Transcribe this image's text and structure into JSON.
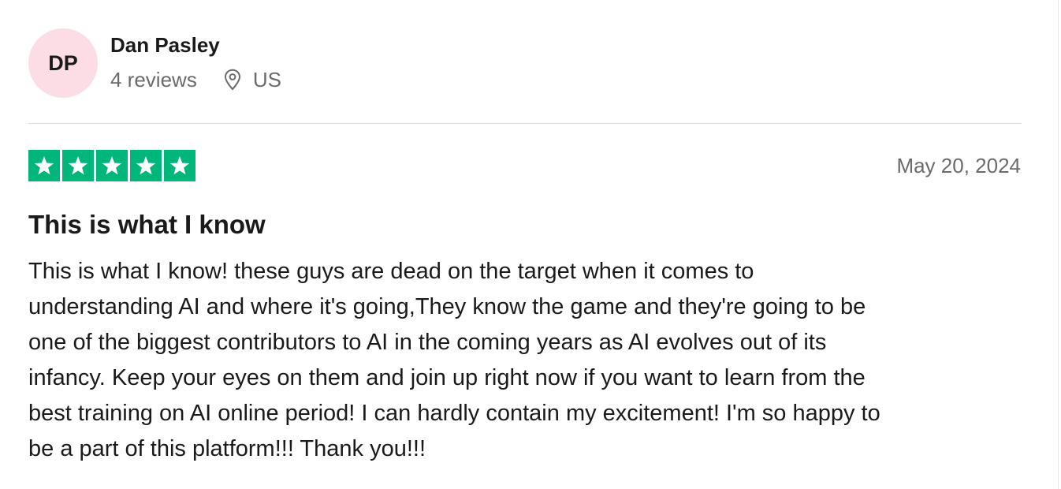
{
  "reviewer": {
    "initials": "DP",
    "name": "Dan Pasley",
    "reviews_count": "4 reviews",
    "location": "US",
    "avatar_color": "#fcdde6",
    "location_icon": "map-pin-icon"
  },
  "review": {
    "rating": 5,
    "rating_max": 5,
    "star_color": "#00b67a",
    "date": "May 20, 2024",
    "title": "This is what I know",
    "body": [
      "This is what I know! these guys are dead on the target when it comes to",
      "understanding AI and where it's going,They know the game and they're going to be",
      "one of the biggest contributors to AI in the coming years as AI evolves out of its",
      "infancy. Keep your eyes on them and join up right now if you want to learn from the",
      "best training on AI online period! I can hardly contain my excitement! I'm so happy to",
      "be a part of this platform!!! Thank you!!!"
    ]
  }
}
